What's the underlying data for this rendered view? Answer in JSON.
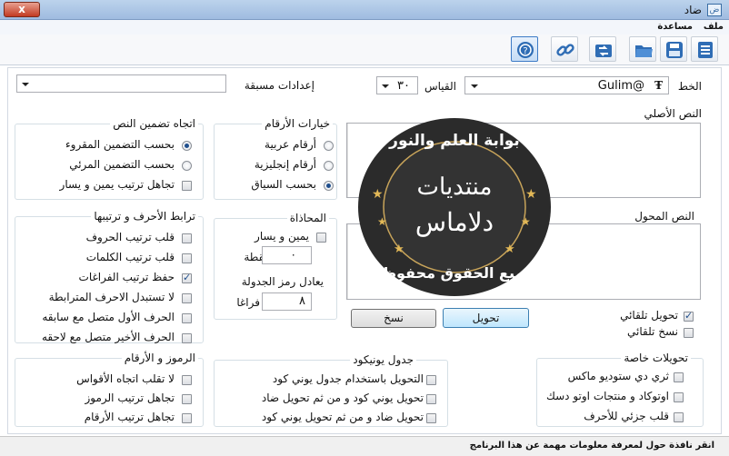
{
  "window": {
    "title": "ضاد",
    "app_icon": "ض",
    "close_label": "x"
  },
  "menu": {
    "items": [
      "ملف",
      "مساعدة"
    ]
  },
  "toolbar": {
    "buttons": [
      "document-icon",
      "save-icon",
      "folder-icon",
      "convert-icon",
      "link-icon",
      "help-icon"
    ]
  },
  "font": {
    "label": "الخط",
    "value": "Gulim@",
    "glyph": "Ŧ"
  },
  "size": {
    "label": "القياس",
    "value": "٣٠"
  },
  "presets": {
    "label": "إعدادات مسبقة",
    "value": ""
  },
  "original_text": {
    "label": "النص الأصلي",
    "value": ""
  },
  "converted_text": {
    "label": "النص المحول",
    "value": ""
  },
  "embed_direction": {
    "title": "اتجاه تضمين النص",
    "options": [
      {
        "label": "بحسب التضمين المقروء",
        "checked": true
      },
      {
        "label": "بحسب التضمين المرئي",
        "checked": false
      }
    ],
    "check": {
      "label": "تجاهل ترتيب يمين و يسار",
      "checked": false
    }
  },
  "digits": {
    "title": "خيارات الأرقام",
    "options": [
      {
        "label": "أرقام عربية",
        "checked": false
      },
      {
        "label": "أرقام إنجليزية",
        "checked": false
      },
      {
        "label": "بحسب السياق",
        "checked": true
      }
    ]
  },
  "letters": {
    "title": "ترابط الأحرف و ترتيبها",
    "options": [
      {
        "label": "قلب ترتيب الحروف",
        "checked": false
      },
      {
        "label": "قلب ترتيب الكلمات",
        "checked": false
      },
      {
        "label": "حفظ ترتيب الفراغات",
        "checked": true
      },
      {
        "label": "لا تستبدل الاحرف المترابطة",
        "checked": false
      },
      {
        "label": "الحرف الأول متصل مع سابقه",
        "checked": false
      },
      {
        "label": "الحرف الأخير متصل مع لاحقه",
        "checked": false
      }
    ]
  },
  "alignment": {
    "title": "المحاذاة",
    "check": {
      "label": "يمين و يسار",
      "checked": false
    },
    "dot_label": "نقطة",
    "dot_value": "٠",
    "tab_label": "يعادل رمز الجدولة",
    "tab_value": "٨",
    "spaces_label": "فراغا"
  },
  "actions": {
    "convert": "تحويل",
    "copy": "نسخ"
  },
  "auto": {
    "convert": {
      "label": "تحويل تلقائي",
      "checked": true
    },
    "copy": {
      "label": "نسخ تلقائي",
      "checked": false
    }
  },
  "symbols": {
    "title": "الرموز و الأرقام",
    "options": [
      {
        "label": "لا تقلب اتجاه الأقواس",
        "checked": false
      },
      {
        "label": "تجاهل ترتيب الرموز",
        "checked": false
      },
      {
        "label": "تجاهل ترتيب الأرقام",
        "checked": false
      }
    ]
  },
  "unicode_table": {
    "title": "جدول يونيكود",
    "options": [
      {
        "label": "التحويل باستخدام جدول يوني كود",
        "checked": false
      },
      {
        "label": "تحويل يوني كود و من ثم تحويل ضاد",
        "checked": false
      },
      {
        "label": "تحويل ضاد و من ثم تحويل يوني كود",
        "checked": false
      }
    ]
  },
  "special": {
    "title": "تحويلات خاصة",
    "options": [
      {
        "label": "ثري دي ستوديو ماكس",
        "checked": false
      },
      {
        "label": "اوتوكاد و منتجات اوتو دسك",
        "checked": false
      },
      {
        "label": "قلب جزئي للأحرف",
        "checked": false
      }
    ]
  },
  "stamp": {
    "top": "بوابة العلم والنور",
    "middle": "منتديات",
    "name": "دلاماس",
    "bottom": "جميع الحقوق محفوظة"
  },
  "status": {
    "text": "انقر نافذة حول لمعرفة معلومات مهمة عن هذا البرنامج"
  },
  "colors": {
    "accent": "#3c7fb1",
    "stamp_bg": "#2b2b2b",
    "stamp_ring": "#c8a45a"
  }
}
